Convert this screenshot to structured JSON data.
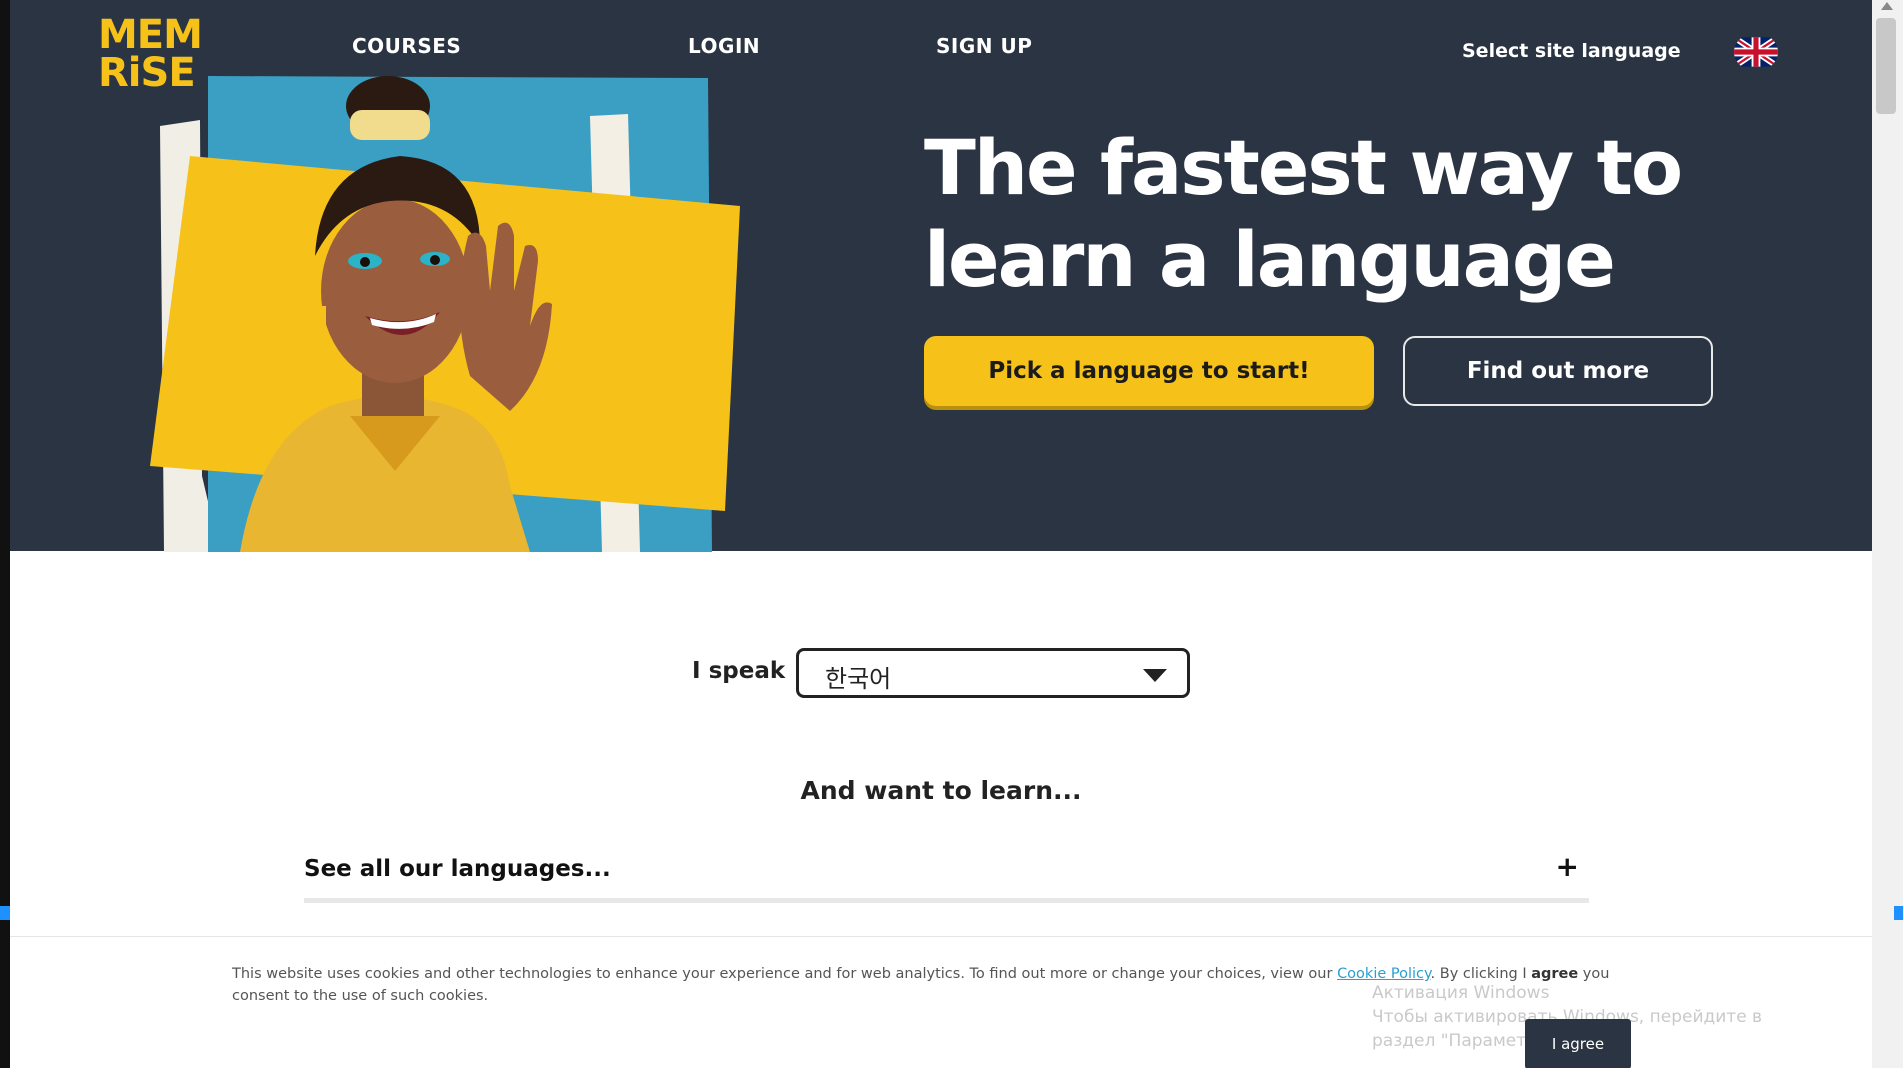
{
  "brand": {
    "logo_line1": "MEM",
    "logo_line2": "RiSE",
    "yellow": "#f6c21a",
    "navy": "#2a3442"
  },
  "nav": {
    "courses": "COURSES",
    "login": "LOGIN",
    "signup": "SIGN UP",
    "site_language": "Select site language",
    "flag_icon": "uk-flag-icon"
  },
  "hero": {
    "headline_line1": "The fastest way to",
    "headline_line2": "learn a language",
    "primary_cta": "Pick a language to start!",
    "secondary_cta": "Find out more"
  },
  "picker": {
    "speak_label": "I speak",
    "selected_language": "한국어",
    "want_label": "And want to learn...",
    "see_all": "See all our languages...",
    "expand_icon": "plus-icon"
  },
  "cookie": {
    "text_before_link": "This website uses cookies and other technologies to enhance your experience and for web analytics. To find out more or change your choices, view our ",
    "link": "Cookie Policy",
    "text_after_link": ". By clicking I ",
    "bold_word": "agree",
    "text_end": " you consent to the use of such cookies.",
    "agree_button": "I agree"
  },
  "watermark": {
    "line1": "Активация Windows",
    "line2": "Чтобы активировать Windows, перейдите в",
    "line3": "раздел \"Параметры\"."
  }
}
